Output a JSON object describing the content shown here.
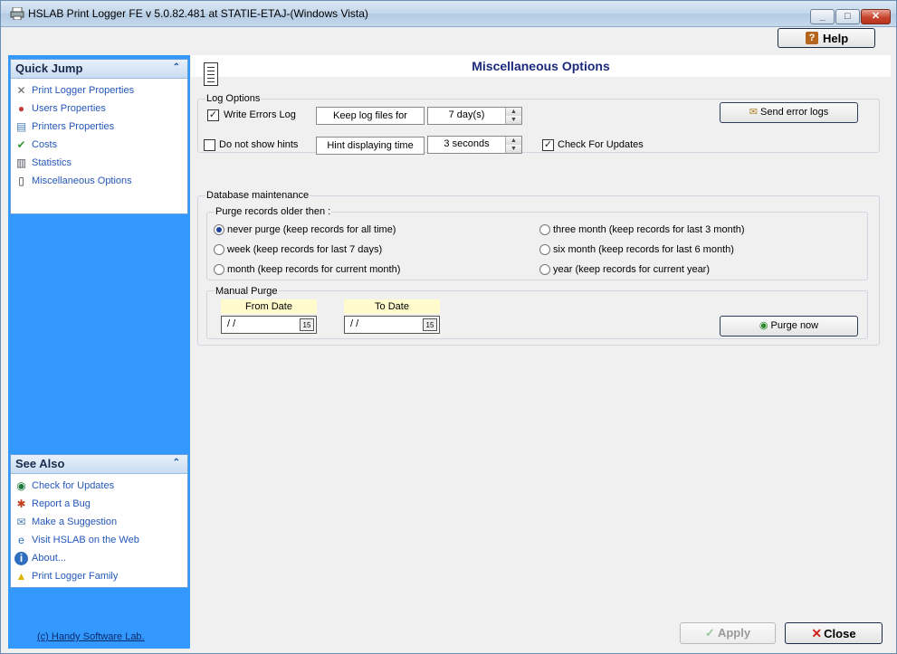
{
  "window": {
    "title": "HSLAB Print Logger FE v 5.0.82.481 at STATIE-ETAJ-(Windows Vista)",
    "min_symbol": "_",
    "max_symbol": "□",
    "close_symbol": "✕"
  },
  "toolbar": {
    "help_label": "Help",
    "help_icon": "?"
  },
  "quick_jump": {
    "title": "Quick Jump",
    "collapse_symbol": "⌃",
    "items": [
      {
        "label": "Print Logger Properties",
        "icon": "tools-icon"
      },
      {
        "label": "Users Properties",
        "icon": "users-icon"
      },
      {
        "label": "Printers Properties",
        "icon": "printer-icon"
      },
      {
        "label": "Costs",
        "icon": "costs-icon"
      },
      {
        "label": "Statistics",
        "icon": "statistics-icon"
      },
      {
        "label": "Miscellaneous Options",
        "icon": "document-icon"
      }
    ]
  },
  "see_also": {
    "title": "See Also",
    "collapse_symbol": "⌃",
    "items": [
      {
        "label": "Check for Updates",
        "icon": "globe-icon"
      },
      {
        "label": "Report a Bug",
        "icon": "bug-icon"
      },
      {
        "label": "Make a Suggestion",
        "icon": "mail-icon"
      },
      {
        "label": "Visit HSLAB on the Web",
        "icon": "web-icon"
      },
      {
        "label": "About...",
        "icon": "info-icon"
      },
      {
        "label": "Print Logger Family",
        "icon": "warning-icon"
      }
    ]
  },
  "copyright": "(c) Handy Software Lab.",
  "page": {
    "title": "Miscellaneous Options"
  },
  "log_options": {
    "group_label": "Log Options",
    "write_errors_label": "Write Errors Log",
    "write_errors_checked": true,
    "keep_log_label": "Keep log files for",
    "keep_log_value": "7 day(s)",
    "send_error_logs_label": "Send error logs",
    "no_hints_label": "Do not show hints",
    "no_hints_checked": false,
    "hint_time_label": "Hint displaying time",
    "hint_time_value": "3 seconds",
    "check_updates_label": "Check For Updates",
    "check_updates_checked": true
  },
  "db": {
    "group_label": "Database maintenance",
    "purge_group_label": "Purge records older then :",
    "options_left": [
      {
        "label": "never purge (keep records for all time)",
        "selected": true
      },
      {
        "label": "week (keep records for last 7 days)",
        "selected": false
      },
      {
        "label": "month (keep records for current month)",
        "selected": false
      }
    ],
    "options_right": [
      {
        "label": "three month (keep records for last 3 month)",
        "selected": false
      },
      {
        "label": "six month (keep records for last 6 month)",
        "selected": false
      },
      {
        "label": "year (keep records for current year)",
        "selected": false
      }
    ],
    "manual_label": "Manual Purge",
    "from_label": "From Date",
    "to_label": "To Date",
    "from_value": " / /",
    "to_value": " / /",
    "calendar_symbol": "15",
    "purge_now_label": "Purge now"
  },
  "footer": {
    "apply_label": "Apply",
    "close_label": "Close"
  },
  "colors": {
    "sidebar": "#3399ff",
    "link": "#2457b8",
    "title": "#1b2a7a",
    "date_header": "#fffbcc"
  }
}
